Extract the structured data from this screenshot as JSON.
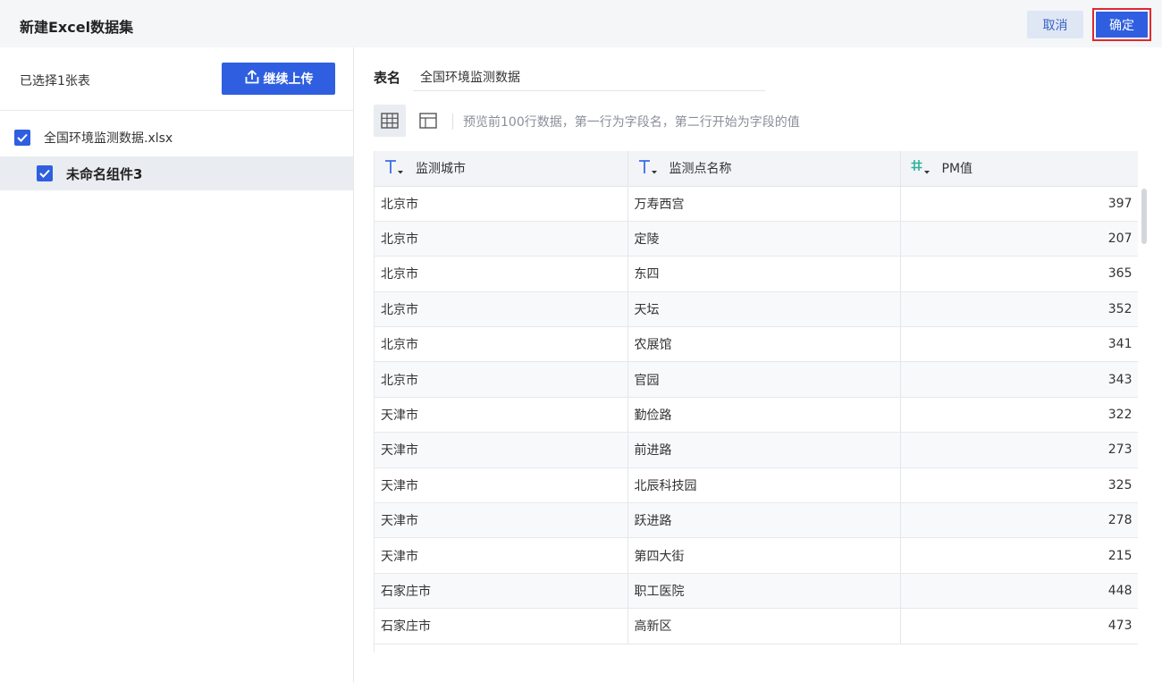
{
  "header": {
    "title": "新建Excel数据集",
    "cancel_label": "取消",
    "confirm_label": "确定"
  },
  "left": {
    "selected_count": "已选择1张表",
    "upload_label": "继续上传",
    "file_name": "全国环境监测数据.xlsx",
    "sheet_name": "未命名组件3"
  },
  "form": {
    "name_label": "表名",
    "name_value": "全国环境监测数据"
  },
  "preview": {
    "hint": "预览前100行数据，第一行为字段名，第二行开始为字段的值"
  },
  "table": {
    "columns": [
      {
        "label": "监测城市",
        "type_icon": "text-type-icon"
      },
      {
        "label": "监测点名称",
        "type_icon": "text-type-icon"
      },
      {
        "label": "PM值",
        "type_icon": "number-type-icon"
      }
    ],
    "rows": [
      [
        "北京市",
        "万寿西宫",
        "397"
      ],
      [
        "北京市",
        "定陵",
        "207"
      ],
      [
        "北京市",
        "东四",
        "365"
      ],
      [
        "北京市",
        "天坛",
        "352"
      ],
      [
        "北京市",
        "农展馆",
        "341"
      ],
      [
        "北京市",
        "官园",
        "343"
      ],
      [
        "天津市",
        "勤俭路",
        "322"
      ],
      [
        "天津市",
        "前进路",
        "273"
      ],
      [
        "天津市",
        "北辰科技园",
        "325"
      ],
      [
        "天津市",
        "跃进路",
        "278"
      ],
      [
        "天津市",
        "第四大街",
        "215"
      ],
      [
        "石家庄市",
        "职工医院",
        "448"
      ],
      [
        "石家庄市",
        "高新区",
        "473"
      ]
    ]
  },
  "colors": {
    "primary": "#2f5fe0",
    "highlight_border": "#e0282e",
    "number_icon": "#2bb39a"
  }
}
